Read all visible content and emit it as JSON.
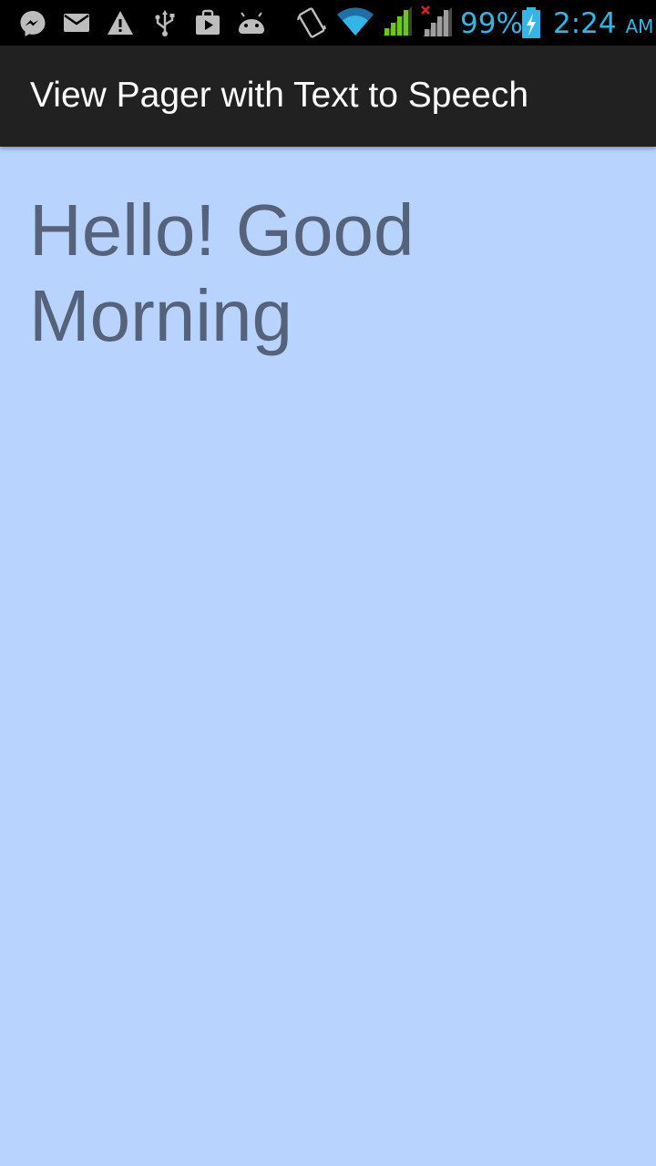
{
  "status_bar": {
    "notification_icons": [
      "messenger-icon",
      "mail-icon",
      "warning-icon",
      "usb-icon",
      "play-store-icon",
      "android-debug-icon"
    ],
    "system_icons": [
      "vibrate-icon",
      "wifi-icon",
      "signal-icon",
      "no-signal-icon",
      "battery-charging-icon"
    ],
    "battery_percent": "99%",
    "time": "2:24",
    "ampm": "AM",
    "accent_color": "#33b5e5"
  },
  "action_bar": {
    "title": "View Pager with Text to Speech"
  },
  "page": {
    "text": "Hello! Good Morning",
    "background_color": "#b7d3fe",
    "text_color": "#56627a"
  }
}
